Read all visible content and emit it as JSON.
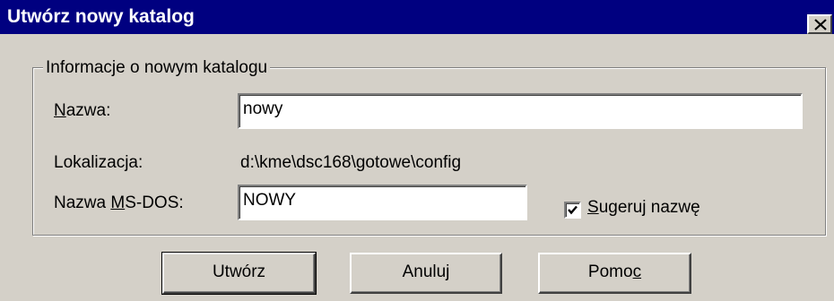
{
  "window": {
    "title": "Utwórz nowy katalog",
    "close_glyph": "close-icon"
  },
  "group": {
    "legend": "Informacje o nowym katalogu"
  },
  "fields": {
    "name_label_accel": "N",
    "name_label_rest": "azwa:",
    "name_value": "nowy",
    "location_label": "Lokalizacja:",
    "location_value": "d:\\kme\\dsc168\\gotowe\\config",
    "msdos_label_pre": "Nazwa ",
    "msdos_label_accel": "M",
    "msdos_label_rest": "S-DOS:",
    "msdos_value": "NOWY"
  },
  "suggest": {
    "checked": true,
    "label_accel": "S",
    "label_rest": "ugeruj nazwę"
  },
  "buttons": {
    "create": "Utwórz",
    "cancel": "Anuluj",
    "help_pre": "Pomo",
    "help_accel": "c"
  },
  "colors": {
    "titlebar": "#000080",
    "face": "#d4d0c8"
  }
}
